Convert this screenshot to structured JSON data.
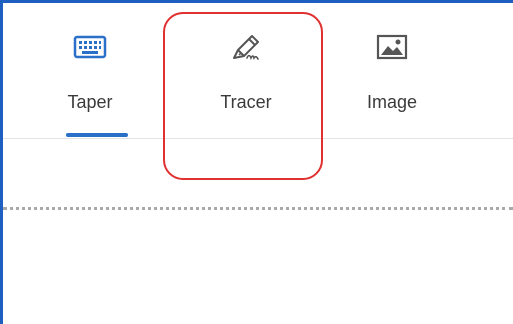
{
  "tabs": [
    {
      "id": "taper",
      "label": "Taper",
      "icon": "keyboard-icon",
      "active": true
    },
    {
      "id": "tracer",
      "label": "Tracer",
      "icon": "pen-signature-icon",
      "active": false
    },
    {
      "id": "image",
      "label": "Image",
      "icon": "image-icon",
      "active": false
    }
  ],
  "colors": {
    "accent": "#2a70c8",
    "window_border": "#1f5fbf",
    "highlight_annotation": "#e03030",
    "label_text": "#3a3a3a"
  }
}
